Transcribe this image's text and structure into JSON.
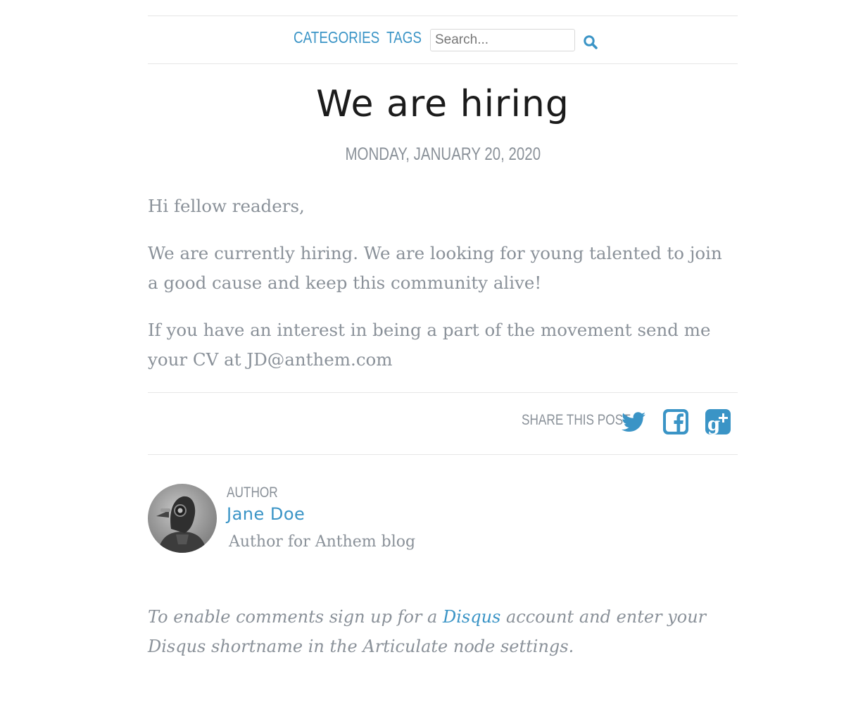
{
  "nav": {
    "categories": "CATEGORIES",
    "tags": "TAGS",
    "search_placeholder": "Search...",
    "search_icon": "search-icon"
  },
  "post": {
    "title": "We are hiring",
    "date": "MONDAY, JANUARY 20, 2020",
    "paragraphs": [
      "Hi fellow readers,",
      "We are currently hiring. We are looking for young talented to join a good cause and keep this community alive!",
      "If you have an interest in being a part of the movement send me your CV at JD@anthem.com"
    ]
  },
  "share": {
    "label": "SHARE THIS POST",
    "icons": [
      "twitter-icon",
      "facebook-icon",
      "google-plus-icon"
    ]
  },
  "author": {
    "label": "AUTHOR",
    "name": "Jane Doe",
    "bio": "Author for Anthem blog"
  },
  "comments": {
    "before": "To enable comments sign up for a ",
    "link": "Disqus",
    "after": " account and enter your Disqus shortname in the Articulate node settings."
  },
  "colors": {
    "accent": "#3a94c6",
    "text": "#8a9199",
    "title": "#1b1b1b"
  }
}
